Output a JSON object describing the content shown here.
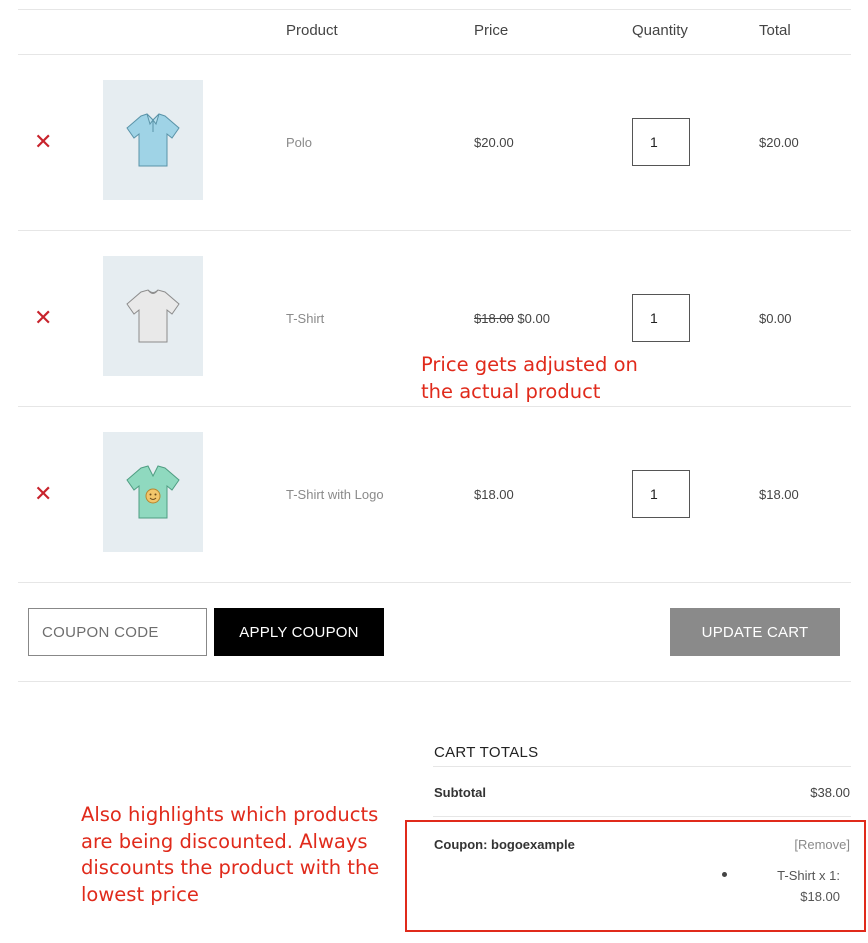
{
  "table": {
    "headers": {
      "product": "Product",
      "price": "Price",
      "quantity": "Quantity",
      "total": "Total"
    },
    "rows": [
      {
        "remove_icon": "close-icon",
        "image_icon": "polo-shirt-icon",
        "name": "Polo",
        "price": "$20.00",
        "old_price": "",
        "quantity": "1",
        "total": "$20.00"
      },
      {
        "remove_icon": "close-icon",
        "image_icon": "tshirt-icon",
        "name": "T-Shirt",
        "price": "$0.00",
        "old_price": "$18.00",
        "quantity": "1",
        "total": "$0.00"
      },
      {
        "remove_icon": "close-icon",
        "image_icon": "tshirt-logo-icon",
        "name": "T-Shirt with Logo",
        "price": "$18.00",
        "old_price": "",
        "quantity": "1",
        "total": "$18.00"
      }
    ],
    "remove_glyph": "✕"
  },
  "actions": {
    "coupon_placeholder": "COUPON CODE",
    "apply_label": "APPLY COUPON",
    "update_label": "UPDATE CART"
  },
  "totals": {
    "title": "CART TOTALS",
    "subtotal_label": "Subtotal",
    "subtotal_value": "$38.00",
    "coupon_label": "Coupon: bogoexample",
    "coupon_remove": "[Remove]",
    "discount_line_1": "T-Shirt x 1:",
    "discount_line_2": "$18.00"
  },
  "annotations": {
    "price_note_1": "Price gets adjusted on",
    "price_note_2": "the actual product",
    "highlight_note_1": "Also highlights which products",
    "highlight_note_2": "are being discounted. Always",
    "highlight_note_3": "discounts the product with the",
    "highlight_note_4": "lowest price"
  },
  "colors": {
    "accent_red": "#e02a1b",
    "remove_red": "#c8232c",
    "apply_button": "#000000",
    "update_button": "#8a8a8a",
    "thumb_bg": "#e6edf1"
  }
}
